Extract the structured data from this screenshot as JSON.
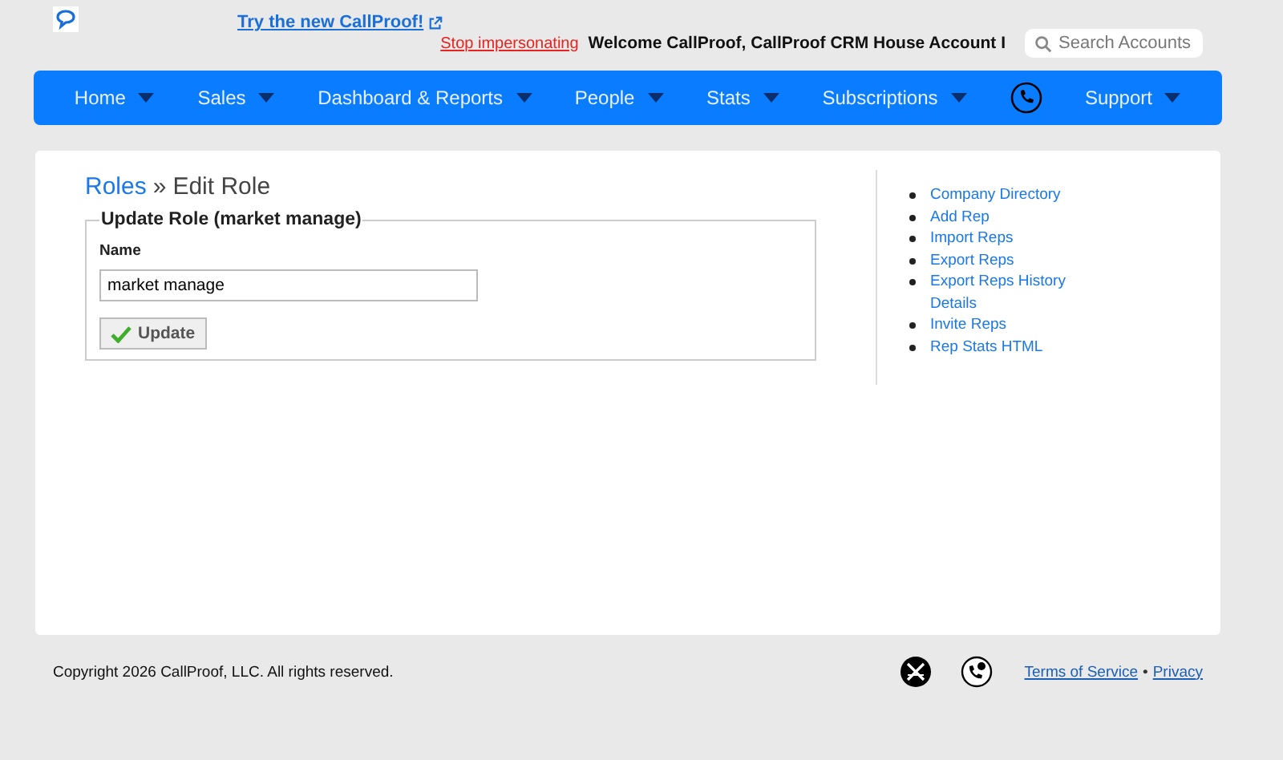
{
  "header": {
    "promo_link": "Try the new CallProof!",
    "stop_link": "Stop impersonating",
    "welcome": "Welcome CallProof, CallProof CRM House Account I",
    "search": {
      "placeholder": "Search Accounts"
    }
  },
  "nav": [
    {
      "label": "Home",
      "kind": "menu"
    },
    {
      "label": "Sales",
      "kind": "menu"
    },
    {
      "label": "Dashboard & Reports",
      "kind": "menu"
    },
    {
      "label": "People",
      "kind": "menu"
    },
    {
      "label": "Stats",
      "kind": "menu"
    },
    {
      "label": "Subscriptions",
      "kind": "menu"
    },
    {
      "kind": "phone"
    },
    {
      "label": "Support",
      "kind": "menu"
    }
  ],
  "breadcrumb": {
    "link": "Roles",
    "separator": "»",
    "current": "Edit Role"
  },
  "form": {
    "legend": "Update Role (market manage)",
    "field_label": "Name",
    "value": "market manage",
    "button": "Update"
  },
  "side_links": [
    "Company Directory",
    "Add Rep",
    "Import Reps",
    "Export Reps",
    "Export Reps History Details",
    "Invite Reps",
    "Rep Stats HTML"
  ],
  "footer": {
    "copyright": "Copyright 2026 CallProof, LLC. All rights reserved.",
    "links": [
      "Terms of Service",
      "Privacy"
    ],
    "separator": "•"
  }
}
